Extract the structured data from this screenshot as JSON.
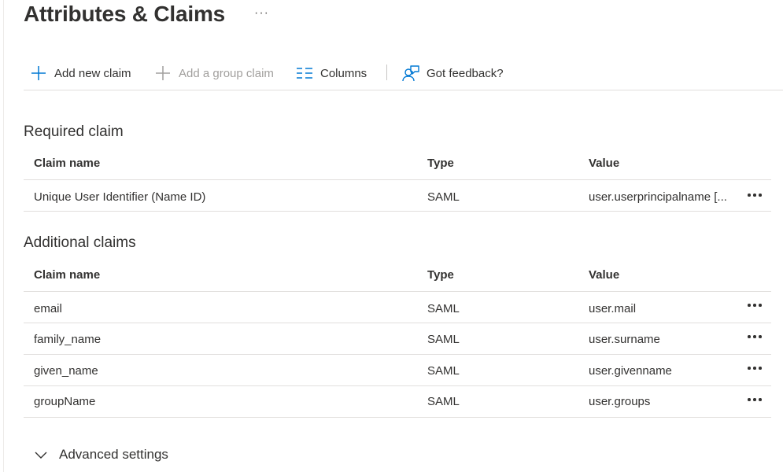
{
  "header": {
    "title": "Attributes & Claims",
    "more_label": "···"
  },
  "toolbar": {
    "add_claim": "Add new claim",
    "add_group_claim": "Add a group claim",
    "columns": "Columns",
    "feedback": "Got feedback?"
  },
  "columns": {
    "claim_name": "Claim name",
    "type": "Type",
    "value": "Value"
  },
  "required": {
    "title": "Required claim",
    "rows": [
      {
        "name": "Unique User Identifier (Name ID)",
        "type": "SAML",
        "value": "user.userprincipalname [..."
      }
    ]
  },
  "additional": {
    "title": "Additional claims",
    "rows": [
      {
        "name": "email",
        "type": "SAML",
        "value": "user.mail"
      },
      {
        "name": "family_name",
        "type": "SAML",
        "value": "user.surname"
      },
      {
        "name": "given_name",
        "type": "SAML",
        "value": "user.givenname"
      },
      {
        "name": "groupName",
        "type": "SAML",
        "value": "user.groups"
      }
    ]
  },
  "advanced": {
    "label": "Advanced settings"
  },
  "colors": {
    "accent": "#0078d4",
    "disabled": "#a19f9d",
    "border": "#e1dfdd"
  },
  "icons": {
    "add": "plus-icon",
    "columns": "columns-icon",
    "feedback": "feedback-icon",
    "more": "more-icon",
    "expand": "chevron-down-icon"
  }
}
